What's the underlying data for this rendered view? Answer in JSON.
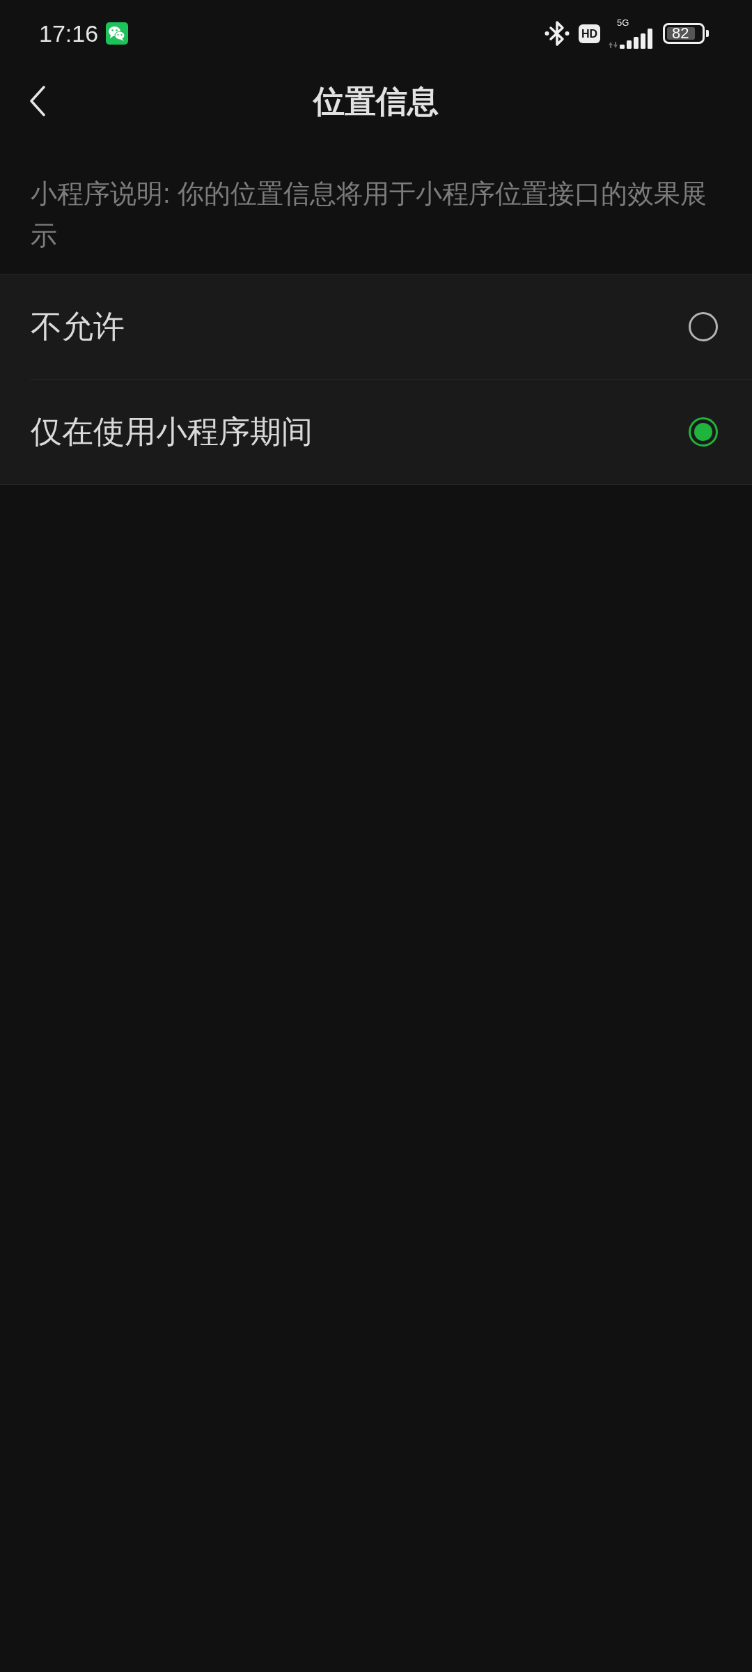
{
  "status_bar": {
    "time": "17:16",
    "hd_badge": "HD",
    "network": "5G",
    "battery": "82"
  },
  "header": {
    "title": "位置信息"
  },
  "description": "小程序说明: 你的位置信息将用于小程序位置接口的效果展示",
  "options": [
    {
      "label": "不允许",
      "selected": false
    },
    {
      "label": "仅在使用小程序期间",
      "selected": true
    }
  ]
}
